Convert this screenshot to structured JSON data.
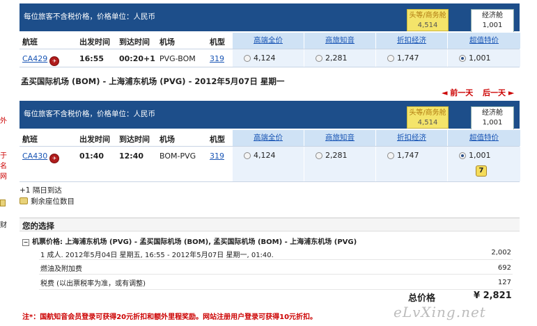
{
  "edge": {
    "t1": "外",
    "t2": "于",
    "t3": "名",
    "t4": "网",
    "t5": "财"
  },
  "block1": {
    "note": "每位旅客不含税价格，价格单位：人民币",
    "cabin_biz": {
      "label": "头等/商务舱",
      "price": "4,514"
    },
    "cabin_eco": {
      "label": "经济舱",
      "price": "1,001"
    },
    "cols": {
      "flight": "航班",
      "dep": "出发时间",
      "arr": "到达时间",
      "airport": "机场",
      "type": "机型"
    },
    "fares": [
      "高端全价",
      "商旅知音",
      "折扣经济",
      "超值特价"
    ],
    "row": {
      "flight": "CA429",
      "dep": "16:55",
      "arr": "00:20+1",
      "airport": "PVG-BOM",
      "type": "319",
      "prices": [
        "4,124",
        "2,281",
        "1,747",
        "1,001"
      ]
    }
  },
  "route_title": "孟买国际机场 (BOM) - 上海浦东机场 (PVG) - 2012年5月07日 星期一",
  "nav": {
    "prev": "◄ 前一天",
    "next": "后一天 ►"
  },
  "block2": {
    "note": "每位旅客不含税价格，价格单位：人民币",
    "cabin_biz": {
      "label": "头等/商务舱",
      "price": "4,514"
    },
    "cabin_eco": {
      "label": "经济舱",
      "price": "1,001"
    },
    "cols": {
      "flight": "航班",
      "dep": "出发时间",
      "arr": "到达时间",
      "airport": "机场",
      "type": "机型"
    },
    "fares": [
      "高端全价",
      "商旅知音",
      "折扣经济",
      "超值特价"
    ],
    "row": {
      "flight": "CA430",
      "dep": "01:40",
      "arr": "12:40",
      "airport": "BOM-PVG",
      "type": "319",
      "prices": [
        "4,124",
        "2,281",
        "1,747",
        "1,001"
      ],
      "seats": "7"
    }
  },
  "legend": {
    "plus1": "+1  隔日到达",
    "seats": "剩余座位数目"
  },
  "choice": {
    "title": "您的选择",
    "toggle": "−",
    "summary": "机票价格: 上海浦东机场 (PVG) - 孟买国际机场 (BOM), 孟买国际机场 (BOM) - 上海浦东机场 (PVG)",
    "line1": "1 成人. 2012年5月04日  星期五, 16:55 - 2012年5月07日  星期一, 01:40.",
    "line1_amt": "2,002",
    "line2": "燃油及附加费",
    "line2_amt": "692",
    "line3": "税费 (以出票税率为准，或有调整)",
    "line3_amt": "127",
    "total_label": "总价格",
    "total_val": "¥ 2,821"
  },
  "note": "注*：国航知音会员登录可获得20元折扣和额外里程奖励。网站注册用户登录可获得10元折扣。",
  "watermark": "eLvXing.net"
}
